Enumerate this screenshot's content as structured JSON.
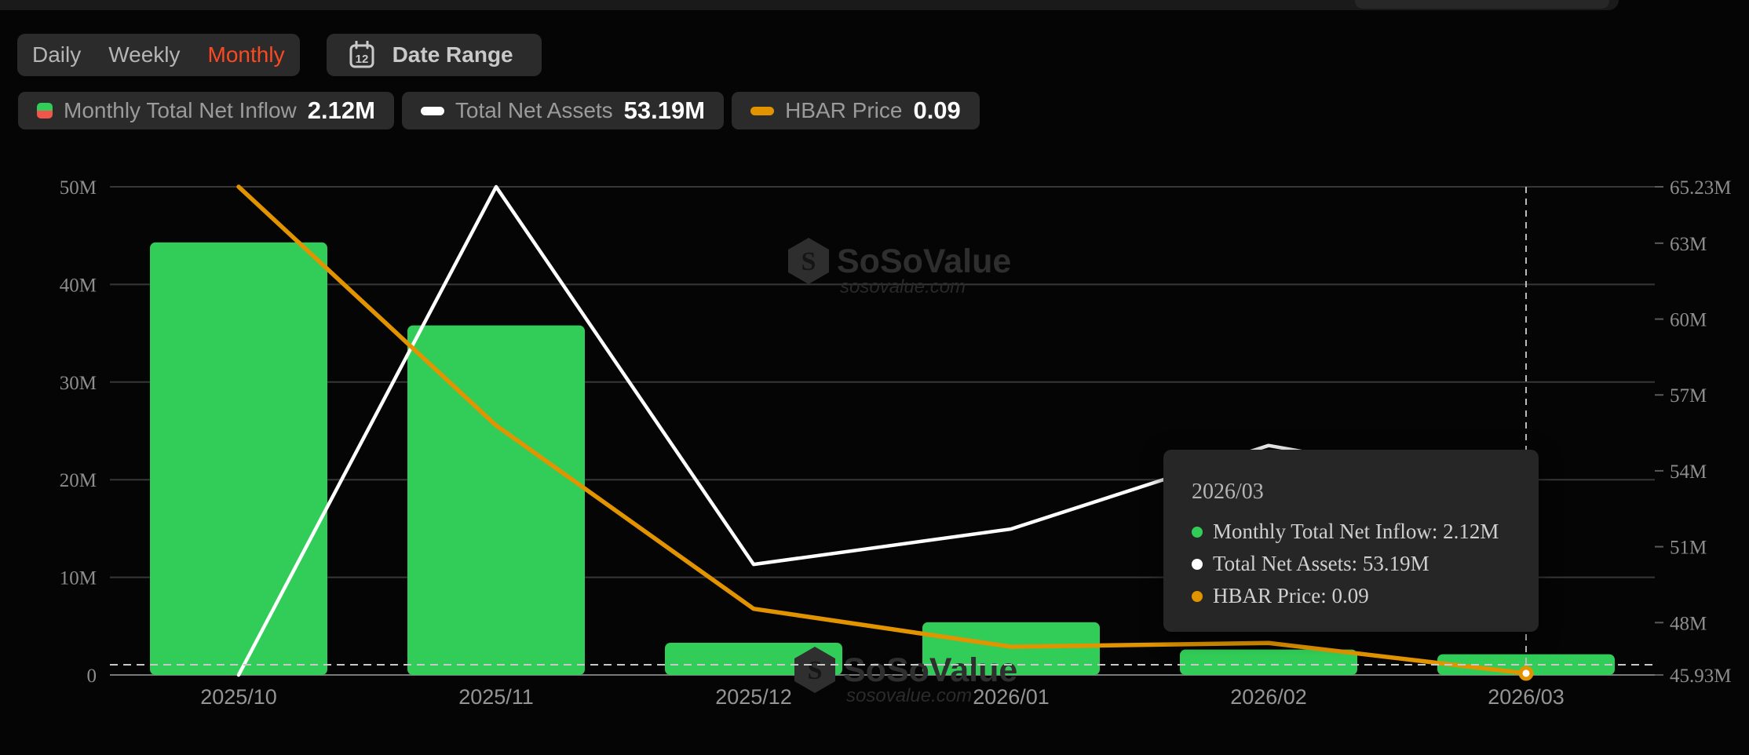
{
  "controls": {
    "tabs": [
      {
        "label": "Daily",
        "active": false
      },
      {
        "label": "Weekly",
        "active": false
      },
      {
        "label": "Monthly",
        "active": true
      }
    ],
    "date_range": {
      "label": "Date Range",
      "icon_day": "12"
    }
  },
  "legend": [
    {
      "label": "Monthly Total Net Inflow",
      "value": "2.12M",
      "icon": "split-green-red-square"
    },
    {
      "label": "Total Net Assets",
      "value": "53.19M",
      "icon": "white-dash"
    },
    {
      "label": "HBAR Price",
      "value": "0.09",
      "icon": "gold-dash"
    }
  ],
  "tooltip": {
    "title": "2026/03",
    "rows": [
      {
        "text": "Monthly Total Net Inflow: 2.12M",
        "dot_color": "#32cd58"
      },
      {
        "text": "Total Net Assets: 53.19M",
        "dot_color": "#ffffff"
      },
      {
        "text": "HBAR Price: 0.09",
        "dot_color": "#e29400"
      }
    ]
  },
  "watermark": {
    "brand": "SoSoValue",
    "domain": "sosovalue.com",
    "logo_letter": "S"
  },
  "colors": {
    "accent": "#fa4a22",
    "bar_green": "#32cd58",
    "legend_red": "#f25549",
    "net_assets_line": "#ffffff",
    "price_line": "#e29400",
    "axis_text": "#8d8d8d",
    "x_axis_text": "#959595",
    "gridline": "#373737",
    "zero_line": "#787878",
    "dashed_line": "#c8c8c8"
  },
  "chart_data": {
    "type": "bar",
    "subtype": "bar+line dual-axis",
    "categories": [
      "2025/10",
      "2025/11",
      "2025/12",
      "2026/01",
      "2026/02",
      "2026/03"
    ],
    "series": [
      {
        "name": "Monthly Total Net Inflow",
        "type": "bar",
        "axis": "left",
        "values": [
          44.3,
          35.8,
          3.3,
          5.4,
          2.6,
          2.12
        ],
        "unit": "M"
      },
      {
        "name": "Total Net Assets",
        "type": "line",
        "axis": "right",
        "values": [
          45.93,
          65.23,
          50.3,
          51.7,
          55.0,
          53.19
        ],
        "unit": "M"
      },
      {
        "name": "HBAR Price",
        "type": "line",
        "axis": "price_hidden",
        "values": [
          0.175,
          0.131,
          0.0972,
          0.0902,
          0.0909,
          0.0853
        ],
        "latest_label": "0.09"
      }
    ],
    "left_axis": {
      "min": 0,
      "max": 50,
      "tick_values": [
        0,
        10,
        20,
        30,
        40,
        50
      ],
      "tick_labels": [
        "0",
        "10M",
        "20M",
        "30M",
        "40M",
        "50M"
      ]
    },
    "right_axis": {
      "min": 45.93,
      "max": 65.23,
      "tick_values": [
        45.93,
        48,
        51,
        54,
        57,
        60,
        63,
        65.23
      ],
      "tick_labels": [
        "45.93M",
        "48M",
        "51M",
        "54M",
        "57M",
        "60M",
        "63M",
        "65.23M"
      ]
    },
    "price_axis": {
      "min": 0.085,
      "max": 0.175,
      "visible": false
    },
    "grid": "horizontal gridlines on",
    "legend_position": "top-left",
    "crosshair_category": "2026/03"
  }
}
